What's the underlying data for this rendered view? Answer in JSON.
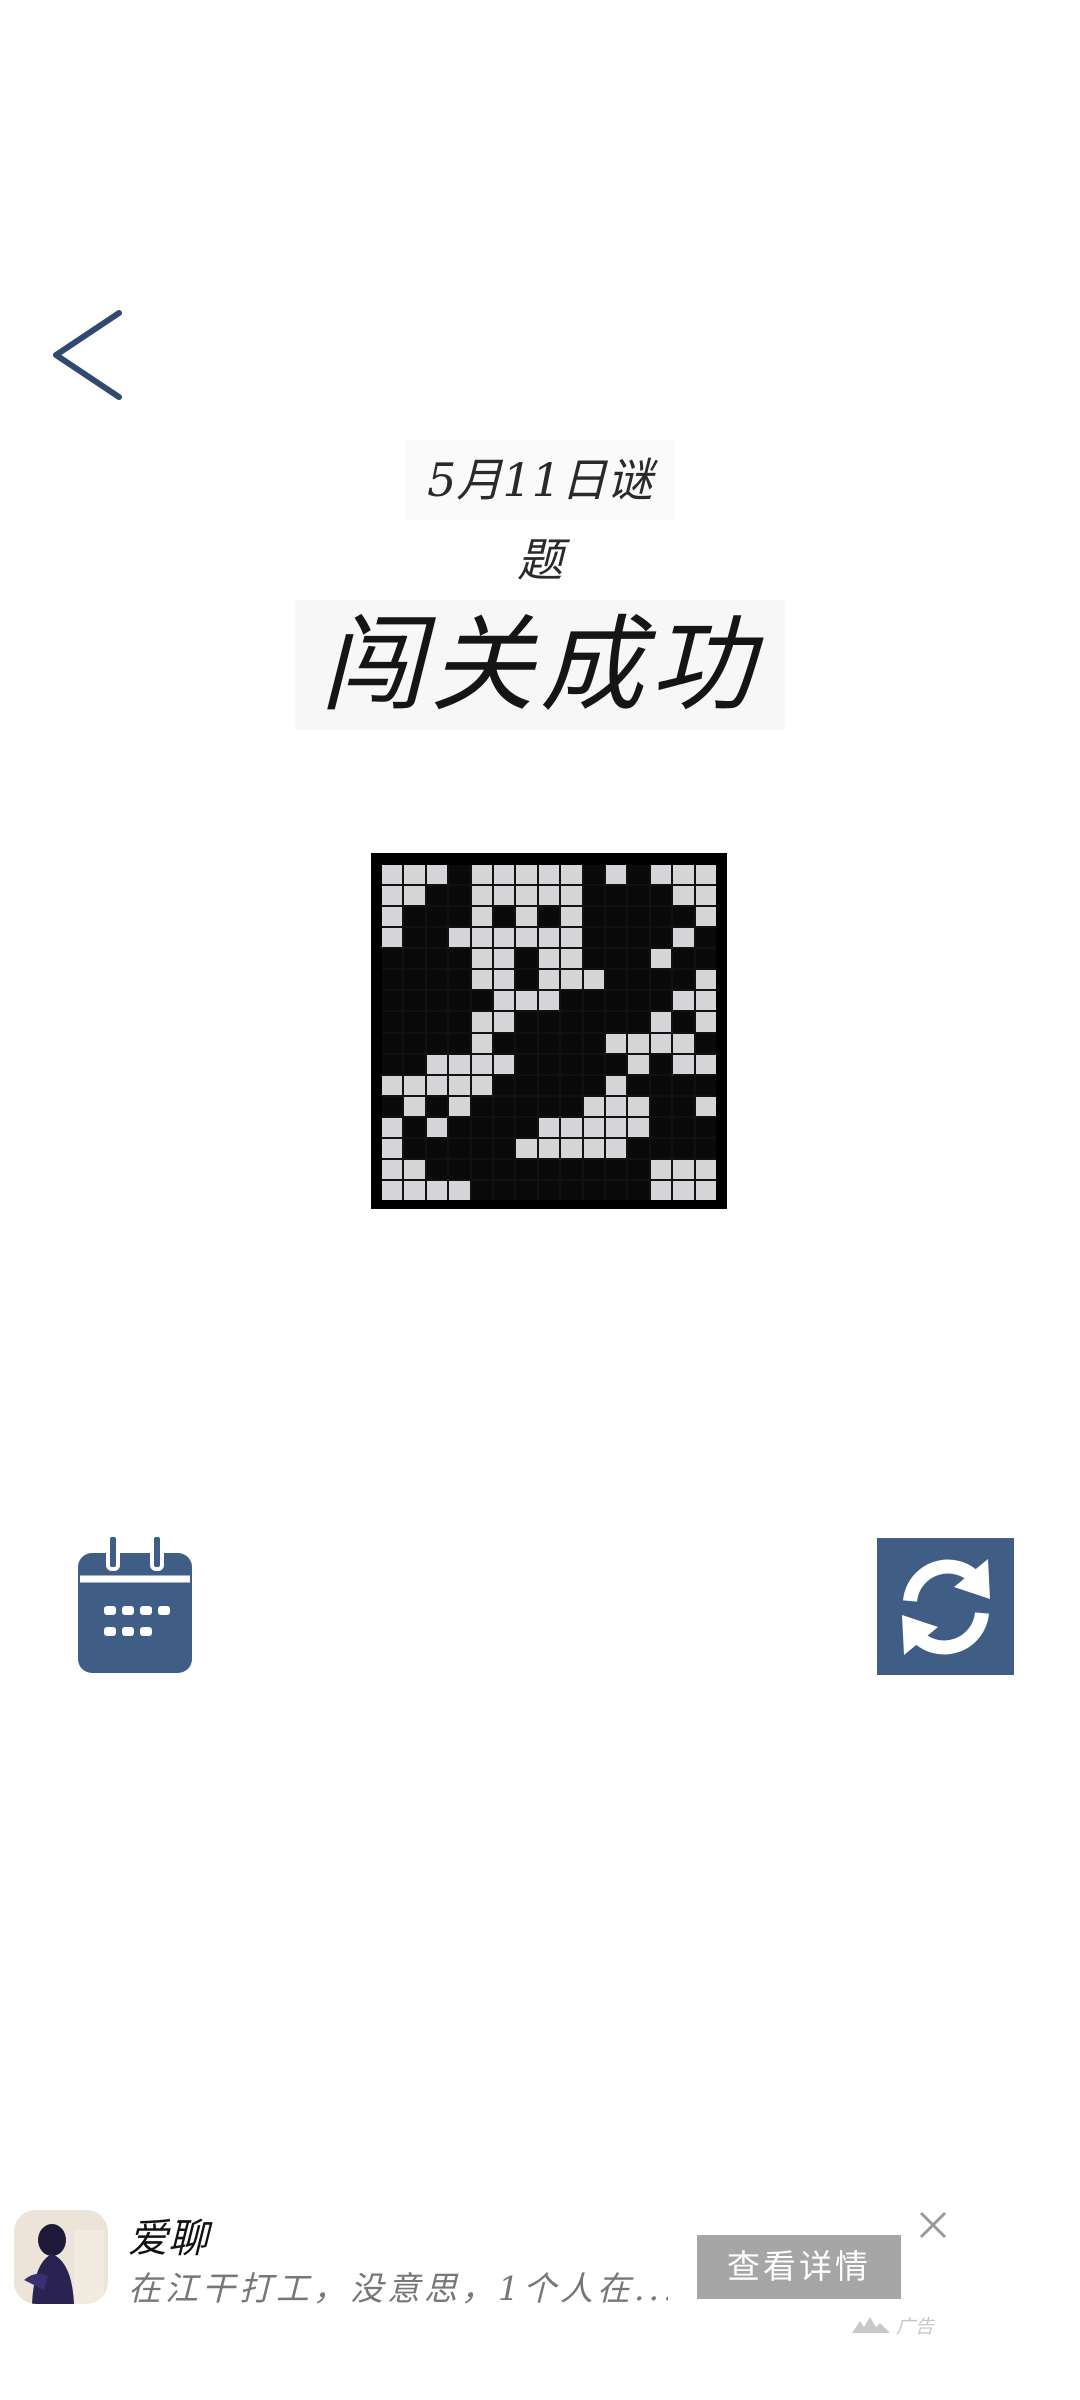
{
  "header": {
    "back_icon": "chevron-left-icon"
  },
  "puzzle": {
    "date_title": "5月11日谜题",
    "status": "闯关成功",
    "grid_rows": [
      "000100000101000",
      "001100000111100",
      "011101010111110",
      "011000000111101",
      "111100100111011",
      "111100100011110",
      "111110001111100",
      "111100111111010",
      "111101111100001",
      "110000111110100",
      "000001111101111",
      "101011111000110",
      "010111100000111",
      "011111000001111",
      "001111111111000",
      "000011111111000"
    ],
    "cell_color_filled": "#0a0a0a",
    "cell_color_empty": "#d5d5d7"
  },
  "controls": {
    "calendar_icon": "calendar-icon",
    "refresh_icon": "refresh-icon",
    "accent_color": "#3f5d85"
  },
  "ad": {
    "app_name": "爱聊",
    "description": "在江干打工，没意思，1个人在...",
    "cta_label": "查看详情",
    "tag_label": "广告",
    "close_icon": "close-icon"
  }
}
